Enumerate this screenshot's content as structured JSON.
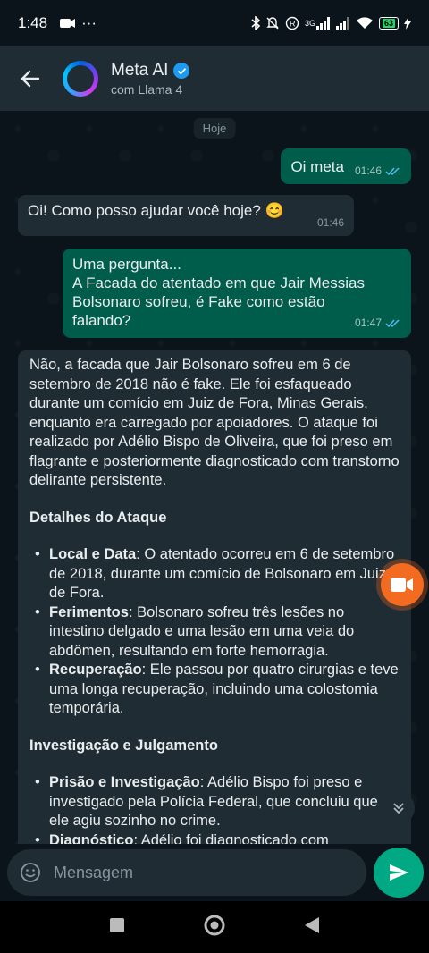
{
  "status_bar": {
    "time": "1:48",
    "network": "3G",
    "battery": "63"
  },
  "header": {
    "title": "Meta AI",
    "subtitle": "com Llama 4"
  },
  "chat": {
    "day_chip": "Hoje",
    "messages": [
      {
        "text": "Oi meta",
        "time": "01:46"
      },
      {
        "text": "Oi! Como posso ajudar você hoje? 😊",
        "time": "01:46"
      },
      {
        "line1": "Uma pergunta...",
        "line2": "A Facada do atentado em que Jair Messias Bolsonaro sofreu, é Fake como estão falando?",
        "time": "01:47"
      }
    ],
    "answer": {
      "intro": "Não, a facada que Jair Bolsonaro sofreu em 6 de setembro de 2018 não é fake. Ele foi esfaqueado durante um comício em Juiz de Fora, Minas Gerais, enquanto era carregado por apoiadores. O ataque foi realizado por Adélio Bispo de Oliveira, que foi preso em flagrante e posteriormente diagnosticado com transtorno delirante persistente.",
      "section1_title": "Detalhes do Ataque",
      "section1_items": [
        {
          "label": "Local e Data",
          "text": ": O atentado ocorreu em 6 de setembro de 2018, durante um comício de Bolsonaro em Juiz de Fora."
        },
        {
          "label": "Ferimentos",
          "text": ": Bolsonaro sofreu três lesões no intestino delgado e uma lesão em uma veia do abdômen, resultando em forte hemorragia."
        },
        {
          "label": "Recuperação",
          "text": ": Ele passou por quatro cirurgias e teve uma longa recuperação, incluindo uma colostomia temporária."
        }
      ],
      "section2_title": "Investigação e Julgamento",
      "section2_items": [
        {
          "label": "Prisão e Investigação",
          "text": ": Adélio Bispo foi preso e investigado pela Polícia Federal, que concluiu que ele agiu sozinho no crime."
        },
        {
          "label": "Diagnóstico",
          "text": ": Adélio foi diagnosticado com"
        }
      ]
    }
  },
  "composer": {
    "placeholder": "Mensagem"
  },
  "colors": {
    "outgoing_bubble": "#005c4b",
    "incoming_bubble": "#202c33",
    "send_button": "#00a884",
    "video_fab": "#f26b21",
    "read_ticks": "#53bdeb"
  },
  "icons": [
    "back-arrow-icon",
    "video-camera-icon",
    "chevrons-down-icon",
    "emoji-icon",
    "send-icon"
  ]
}
